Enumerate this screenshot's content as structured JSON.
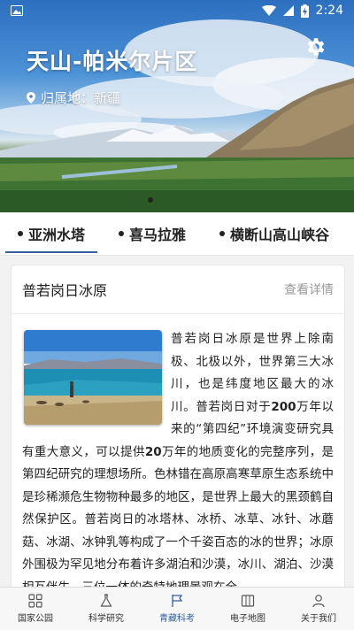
{
  "status_bar": {
    "time": "2:24"
  },
  "hero": {
    "title": "天山-帕米尔片区",
    "location": "归属地：新疆"
  },
  "tabs": [
    {
      "label": "亚洲水塔"
    },
    {
      "label": "喜马拉雅"
    },
    {
      "label": "横断山高山峡谷"
    }
  ],
  "card": {
    "title": "普若岗日冰原",
    "more": "查看详情",
    "para": {
      "t1": "普若岗日冰原是世界上除南极、北极以外，世界第三大冰川，也是纬度地区最大的冰川。普若岗日对于",
      "b1": "200",
      "t2": "万年以来的“第四纪”环境演变研究具有重大意义，可以提供",
      "b2": "20",
      "t3": "万年的地质变化的完整序列，是第四纪研究的理想场所。色林错在高原高寒草原生态系统中是珍稀濒危生物物种最多的地区，是世界上最大的黑颈鹤自然保护区。普若岗日的冰塔林、冰桥、冰草、冰针、冰蘑菇、冰湖、冰钟乳等构成了一个千姿百态的冰的世界；冰原外围极为罕见地分布着许多湖泊和沙漠，冰川、湖泊、沙漠相互伴生，三位一体的奇特地理景观在全"
    }
  },
  "bottom_nav": [
    {
      "label": "国家公园",
      "icon": "grid-icon"
    },
    {
      "label": "科学研究",
      "icon": "flask-icon"
    },
    {
      "label": "青藏科考",
      "icon": "flag-icon"
    },
    {
      "label": "电子地图",
      "icon": "map-icon"
    },
    {
      "label": "关于我们",
      "icon": "user-icon"
    }
  ],
  "colors": {
    "accent": "#355fa0"
  }
}
